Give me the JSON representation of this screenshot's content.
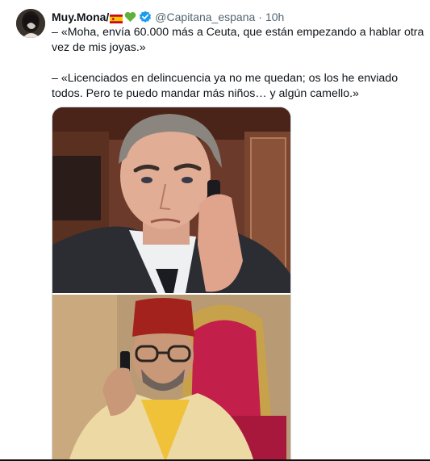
{
  "author": {
    "display_name": "Muy.Mona/",
    "handle": "@Capitana_espana",
    "time_separator": "·",
    "time": "10h",
    "emoji": [
      "spain-flag",
      "green-heart"
    ],
    "verified": true
  },
  "tweet": {
    "paragraphs": [
      "– «Moha, envía 60.000 más a Ceuta, que están empezando a hablar otra vez de mis joyas.»",
      "– «Licenciados en delincuencia ya no me quedan; os los he enviado todos. Pero te puedo mandar más niños… y algún camello.»"
    ]
  },
  "media": {
    "images": [
      {
        "subject": "man in dark suit and tie talking on a mobile phone in parliament"
      },
      {
        "subject": "man with red fez and glasses talking on a mobile phone in front of a red throne"
      }
    ]
  },
  "colors": {
    "text": "#0f1419",
    "secondary": "#536471",
    "verified": "#1d9bf0",
    "border": "#cfd9de"
  }
}
